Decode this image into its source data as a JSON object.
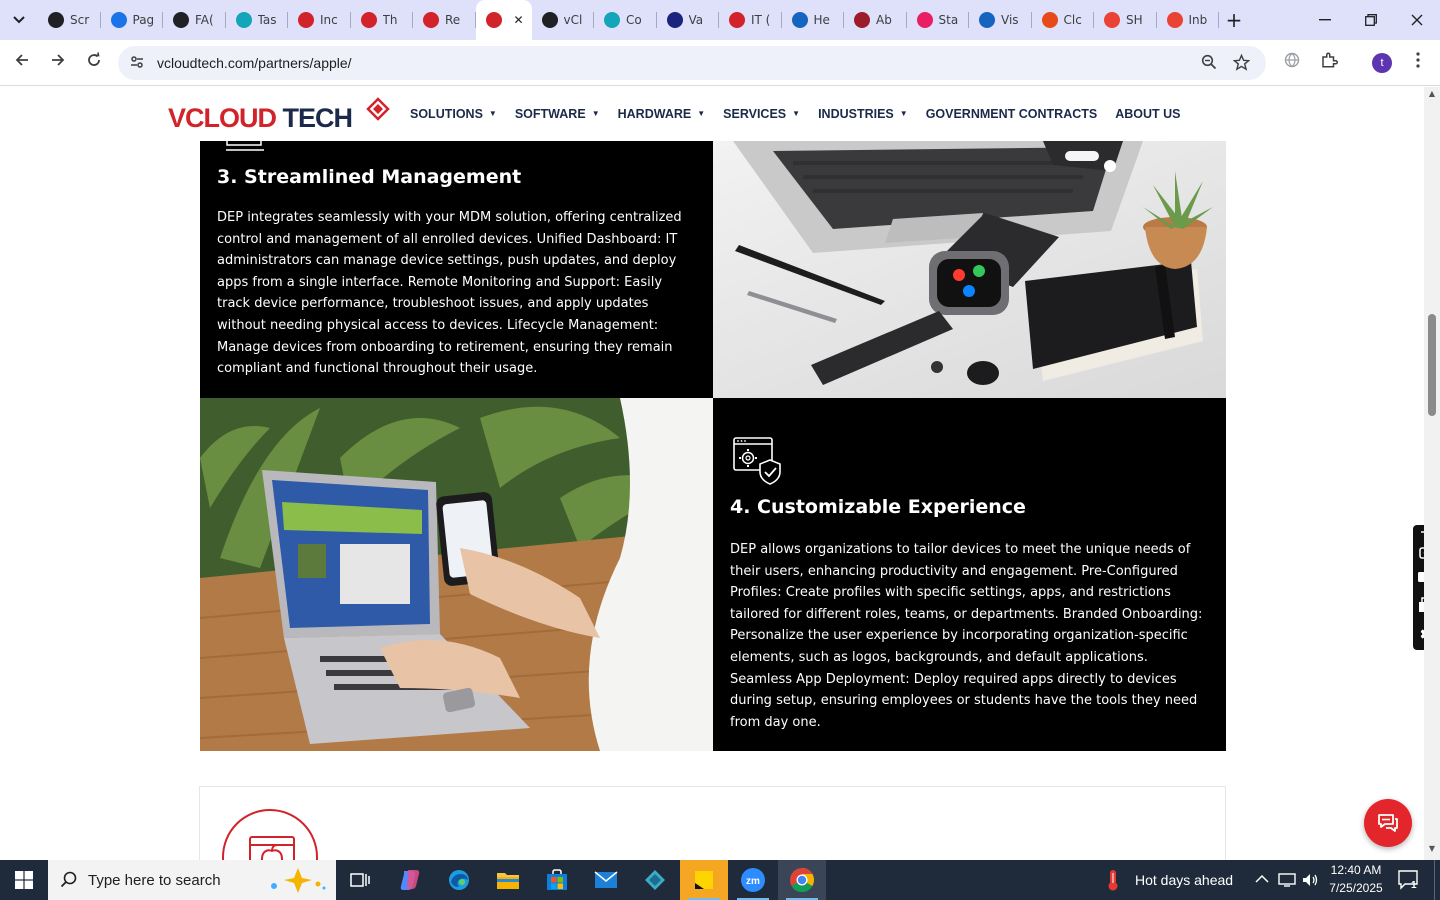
{
  "browser": {
    "tabs": [
      {
        "label": "Scr",
        "color": "#202124"
      },
      {
        "label": "Pag",
        "color": "#1a73e8"
      },
      {
        "label": "FA(",
        "color": "#202124"
      },
      {
        "label": "Tas",
        "color": "#14a6b8"
      },
      {
        "label": "Inc",
        "color": "#d2232a"
      },
      {
        "label": "Th",
        "color": "#d2232a"
      },
      {
        "label": "Re",
        "color": "#d2232a"
      },
      {
        "label": "",
        "color": "#d2232a",
        "active": true
      },
      {
        "label": "vCl",
        "color": "#202124"
      },
      {
        "label": "Co",
        "color": "#14a6b8"
      },
      {
        "label": "Va",
        "color": "#1a237e"
      },
      {
        "label": "IT (",
        "color": "#d2232a"
      },
      {
        "label": "He",
        "color": "#1565c0"
      },
      {
        "label": "Ab",
        "color": "#9c1c2c"
      },
      {
        "label": "Sta",
        "color": "#e91e63"
      },
      {
        "label": "Vis",
        "color": "#1565c0"
      },
      {
        "label": "Clc",
        "color": "#e64a19"
      },
      {
        "label": "SH",
        "color": "#ea4335"
      },
      {
        "label": "Inb",
        "color": "#ea4335"
      }
    ],
    "url": "vcloudtech.com/partners/apple/"
  },
  "site": {
    "logo_primary": "VCLOUD",
    "logo_secondary": " TECH",
    "nav": [
      {
        "label": "SOLUTIONS",
        "dropdown": true
      },
      {
        "label": "SOFTWARE",
        "dropdown": true
      },
      {
        "label": "HARDWARE",
        "dropdown": true
      },
      {
        "label": "SERVICES",
        "dropdown": true
      },
      {
        "label": "INDUSTRIES",
        "dropdown": true
      },
      {
        "label": "GOVERNMENT CONTRACTS",
        "dropdown": false
      },
      {
        "label": "ABOUT US",
        "dropdown": false
      }
    ]
  },
  "features": {
    "streamlined": {
      "title": "3. Streamlined Management",
      "body": "DEP integrates seamlessly with your MDM solution, offering centralized control and management of all enrolled devices. Unified Dashboard: IT administrators can manage device settings, push updates, and deploy apps from a single interface. Remote Monitoring and Support: Easily track device performance, troubleshoot issues, and apply updates without needing physical access to devices. Lifecycle Management: Manage devices from onboarding to retirement, ensuring they remain compliant and functional throughout their usage."
    },
    "customizable": {
      "title": "4. Customizable Experience",
      "body": "DEP allows organizations to tailor devices to meet the unique needs of their users, enhancing productivity and engagement. Pre-Configured Profiles: Create profiles with specific settings, apps, and restrictions tailored for different roles, teams, or departments. Branded Onboarding: Personalize the user experience by incorporating organization-specific elements, such as logos, backgrounds, and default applications. Seamless App Deployment: Deploy required apps directly to devices during setup, ensuring employees or students have the tools they need from day one."
    }
  },
  "taskbar": {
    "search_placeholder": "Type here to search",
    "weather": "Hot days ahead",
    "time": "12:40 AM",
    "date": "7/25/2025",
    "notification_count": "1"
  },
  "colors": {
    "brand_red": "#d2232a",
    "brand_navy": "#1b2a4a",
    "panel_black": "#000000"
  }
}
